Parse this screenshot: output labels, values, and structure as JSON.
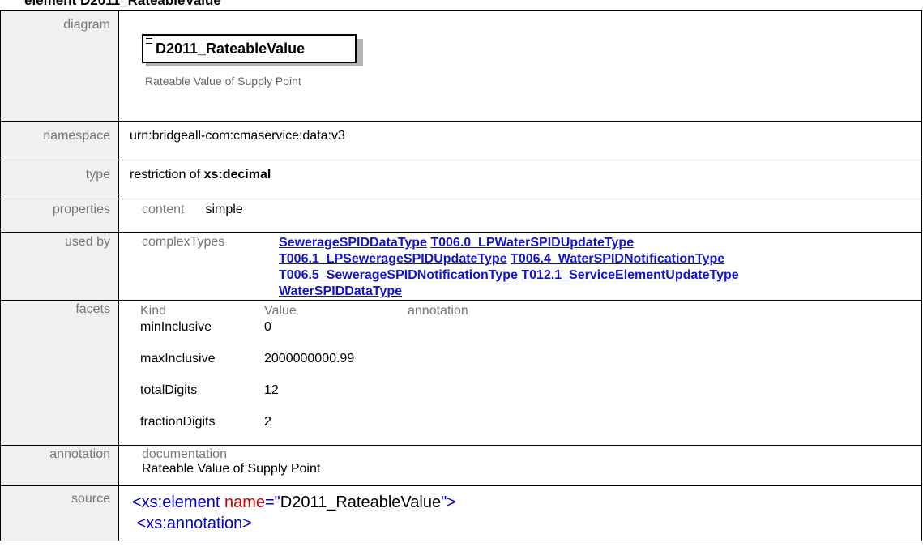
{
  "heading": "element D2011_RateableValue",
  "rows": {
    "diagram": {
      "label": "diagram",
      "element_name": "D2011_RateableValue",
      "element_doc": "Rateable Value of Supply Point"
    },
    "namespace": {
      "label": "namespace",
      "value": "urn:bridgeall-com:cmaservice:data:v3"
    },
    "type": {
      "label": "type",
      "prefix": "restriction of ",
      "base": "xs:decimal"
    },
    "properties": {
      "label": "properties",
      "key": "content",
      "value": "simple"
    },
    "used_by": {
      "label": "used by",
      "kind": "complexTypes",
      "links": [
        "SewerageSPIDDataType",
        "T006.0_LPWaterSPIDUpdateType",
        "T006.1_LPSewerageSPIDUpdateType",
        "T006.4_WaterSPIDNotificationType",
        "T006.5_SewerageSPIDNotificationType",
        "T012.1_ServiceElementUpdateType",
        "WaterSPIDDataType"
      ]
    },
    "facets": {
      "label": "facets",
      "headers": [
        "Kind",
        "Value",
        "annotation"
      ],
      "items": [
        {
          "kind": "minInclusive",
          "value": "0"
        },
        {
          "kind": "maxInclusive",
          "value": "2000000000.99"
        },
        {
          "kind": "totalDigits",
          "value": "12"
        },
        {
          "kind": "fractionDigits",
          "value": "2"
        }
      ]
    },
    "annotation": {
      "label": "annotation",
      "kind": "documentation",
      "text": "Rateable Value of Supply Point"
    },
    "source": {
      "label": "source",
      "line1_open": "<xs:element ",
      "line1_attr": "name",
      "line1_eq": "=\"",
      "line1_val": "D2011_RateableValue",
      "line1_close": "\">",
      "line2": " <xs:annotation>"
    }
  }
}
